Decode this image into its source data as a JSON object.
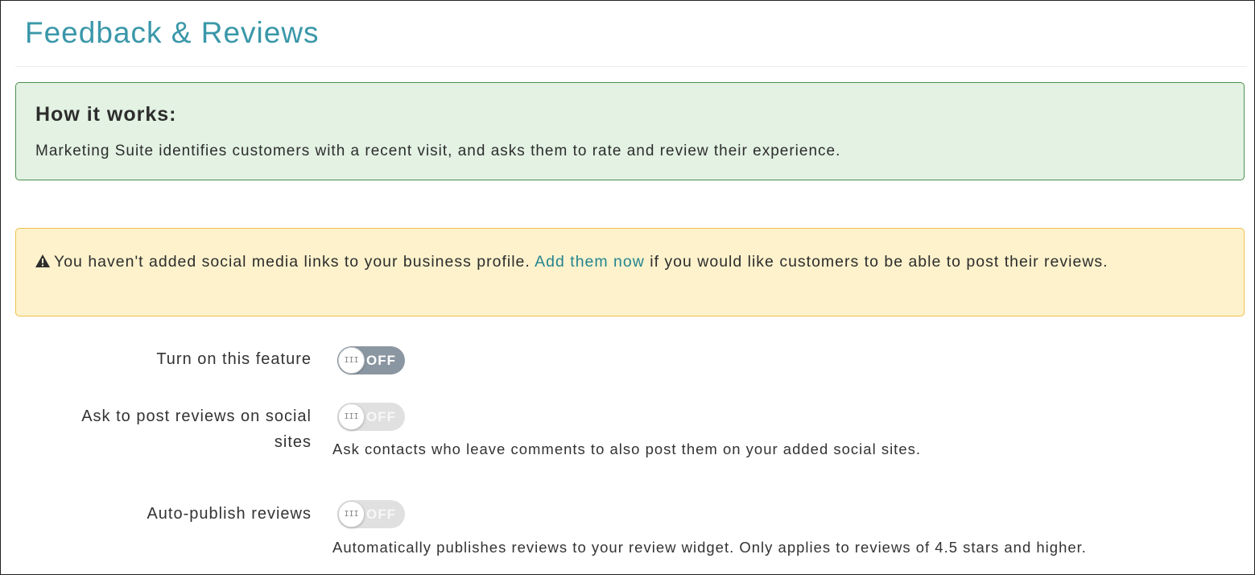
{
  "page": {
    "title": "Feedback & Reviews"
  },
  "info_box": {
    "heading": "How it works:",
    "text": "Marketing Suite identifies customers with a recent visit, and asks them to rate and review their experience."
  },
  "warning_box": {
    "icon": "warning-triangle-icon",
    "text_before": "You haven't added social media links to your business profile. ",
    "link_text": "Add them now",
    "text_after": " if you would like customers to be able to post their reviews."
  },
  "settings": [
    {
      "label": "Turn on this feature",
      "toggle_state": "OFF",
      "enabled": true,
      "description": ""
    },
    {
      "label_line1": "Ask to post reviews on social",
      "label_line2": "sites",
      "toggle_state": "OFF",
      "enabled": false,
      "description": "Ask contacts who leave comments to also post them on your added social sites."
    },
    {
      "label": "Auto-publish reviews",
      "toggle_state": "OFF",
      "enabled": false,
      "description": "Automatically publishes reviews to your review widget. Only applies to reviews of 4.5 stars and higher."
    }
  ],
  "colors": {
    "title": "#3a97a9",
    "info_bg": "#e3f2e3",
    "info_border": "#4c8f4c",
    "warn_bg": "#fdf2cc",
    "warn_border": "#efbf4c",
    "link": "#24848f",
    "toggle_active": "#8a96a1",
    "toggle_disabled": "#e0e0e0"
  },
  "toggle_grip_glyph": "III"
}
